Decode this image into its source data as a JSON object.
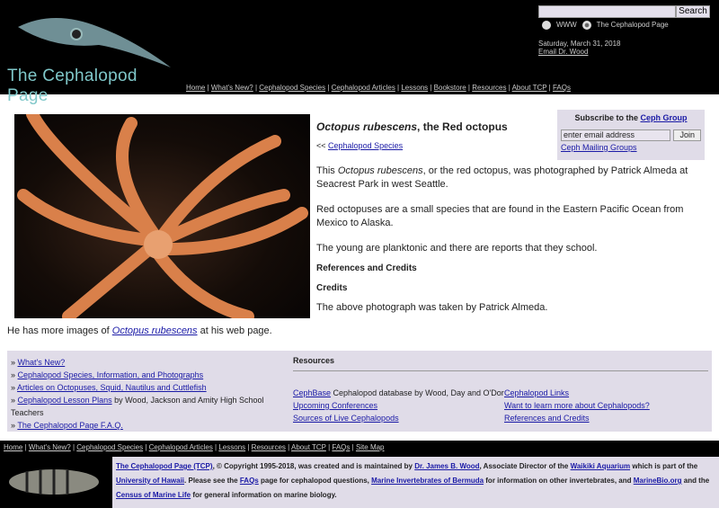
{
  "header": {
    "logo_text": "The Cephalopod Page",
    "search_button": "Search",
    "radio_www": "WWW",
    "radio_site": "The Cephalopod Page",
    "date": "Saturday, March 31, 2018",
    "email": "Email Dr. Wood"
  },
  "nav": [
    "Home",
    "What's New?",
    "Cephalopod Species",
    "Cephalopod Articles",
    "Lessons",
    "Bookstore",
    "Resources",
    "About TCP",
    "FAQs"
  ],
  "article": {
    "title_species": "Octopus rubescens",
    "title_rest": ", the Red octopus",
    "back": "<<",
    "back_link": "Cephalopod Species",
    "p1a": "This ",
    "p1b": "Octopus rubescens",
    "p1c": ", or the red octopus, was photographed by Patrick Almeda at Seacrest Park in west Seattle.",
    "p2": "Red octopuses are a small species that are found in the Eastern Pacific Ocean from Mexico to Alaska.",
    "p3": "The young are planktonic and there are reports that they school.",
    "h_refs": "References and Credits",
    "h_credits": "Credits",
    "p4": "The above photograph was taken by Patrick Almeda.",
    "more_a": "He has more images of ",
    "more_link": "Octopus rubescens",
    "more_b": " at his web page."
  },
  "subscribe": {
    "label": "Subscribe to the ",
    "link": "Ceph Group",
    "placeholder": "enter email address",
    "join": "Join",
    "groups": "Ceph Mailing Groups"
  },
  "links": {
    "items": [
      "What's New?",
      "Cephalopod Species, Information, and Photographs",
      "Articles on Octopuses, Squid, Nautilus and Cuttlefish",
      "Cephalopod Lesson Plans",
      "The Cephalopod Page F.A.Q."
    ],
    "lesson_suffix": " by Wood, Jackson and Amity High School Teachers",
    "resources_title": "Resources",
    "cephbase": "CephBase",
    "cephbase_desc": " Cephalopod database by Wood, Day and O'Dor",
    "conf": "Upcoming Conferences",
    "live": "Sources of Live Cephalopods",
    "ceph_links": "Cephalopod Links",
    "learn": "Want to learn more about Cephalopods?",
    "refs": "References and Credits"
  },
  "footer_nav": [
    "Home",
    "What's New?",
    "Cephalopod Species",
    "Cephalopod Articles",
    "Lessons",
    "Resources",
    "About TCP",
    "FAQs",
    "Site Map"
  ],
  "footer": {
    "l1": "The Cephalopod Page (TCP)",
    "t1": ", © Copyright 1995-2018, was created and is maintained by ",
    "l2": "Dr. James B. Wood",
    "t2": ", Associate Director of the ",
    "l3": "Waikiki Aquarium",
    "t3": " which is part of the ",
    "l4": "University of Hawaii",
    "t4": ". Please see the ",
    "l5": "FAQs",
    "t5": " page for cephalopod questions, ",
    "l6": "Marine Invertebrates of Bermuda",
    "t6": " for information on other invertebrates, and ",
    "l7": "MarineBio.org",
    "t7": " and the ",
    "l8": "Census of Marine Life",
    "t8": " for general information on marine biology."
  }
}
